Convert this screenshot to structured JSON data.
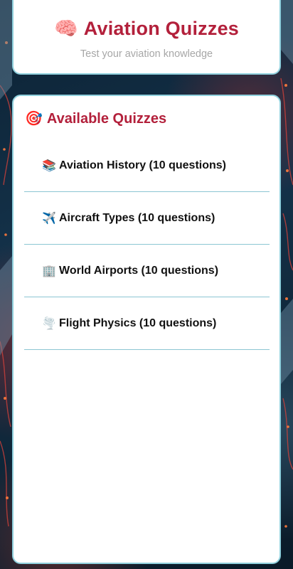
{
  "header": {
    "title_icon": "🧠",
    "title": "Aviation Quizzes",
    "subtitle": "Test your aviation knowledge"
  },
  "quizzes_section": {
    "heading_icon": "🎯",
    "heading": "Available Quizzes",
    "items": [
      {
        "icon": "📚",
        "icon_name": "books-icon",
        "label": "Aviation History (10 questions)"
      },
      {
        "icon": "✈️",
        "icon_name": "airplane-icon",
        "label": "Aircraft Types (10 questions)"
      },
      {
        "icon": "🏢",
        "icon_name": "building-icon",
        "label": "World Airports (10 questions)"
      },
      {
        "icon": "🌪️",
        "icon_name": "tornado-icon",
        "label": "Flight Physics (10 questions)"
      }
    ]
  },
  "colors": {
    "accent": "#b3203b",
    "card_border": "#8fd0dd",
    "divider": "#8cc6d3",
    "subtitle": "#a7a7a7"
  }
}
